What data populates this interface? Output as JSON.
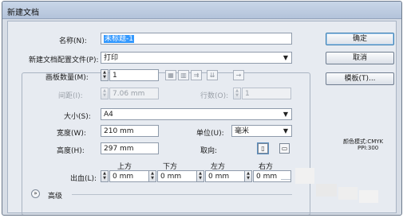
{
  "window": {
    "title": "新建文档"
  },
  "name": {
    "label": "名称(N):",
    "value": "未标题-1"
  },
  "profile": {
    "label": "新建文档配置文件(P):",
    "value": "打印"
  },
  "artboards": {
    "count_label": "画板数量(M):",
    "count_value": "1",
    "spacing_label": "间距(I):",
    "spacing_value": "7.06 mm",
    "columns_label": "行数(O):",
    "columns_value": "1"
  },
  "size": {
    "label": "大小(S):",
    "value": "A4"
  },
  "width": {
    "label": "宽度(W):",
    "value": "210 mm"
  },
  "height": {
    "label": "高度(H):",
    "value": "297 mm"
  },
  "units": {
    "label": "单位(U):",
    "value": "毫米"
  },
  "orientation": {
    "label": "取向:"
  },
  "bleed": {
    "label": "出血(L):",
    "top_label": "上方",
    "bottom_label": "下方",
    "left_label": "左方",
    "right_label": "右方",
    "top": "0 mm",
    "bottom": "0 mm",
    "left": "0 mm",
    "right": "0 mm"
  },
  "advanced": {
    "label": "高级"
  },
  "buttons": {
    "ok": "确定",
    "cancel": "取消",
    "templates": "模板(T)..."
  },
  "info": {
    "color_mode": "颜色模式:CMYK",
    "ppi": "PPI:300"
  },
  "icons": {
    "spinner_up": "▲",
    "spinner_down": "▼",
    "dropdown": "▼",
    "expand": "»"
  }
}
